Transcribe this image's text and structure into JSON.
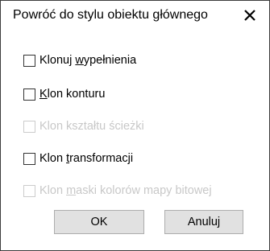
{
  "dialog": {
    "title": "Powróć do stylu obiektu głównego",
    "close_icon": "close-icon"
  },
  "options": [
    {
      "pre": "Klonuj ",
      "u": "w",
      "post": "ypełnienia",
      "checked": false,
      "disabled": false
    },
    {
      "pre": "",
      "u": "K",
      "post": "lon konturu",
      "checked": false,
      "disabled": false
    },
    {
      "pre": "Klon kształtu ścieżki",
      "u": "",
      "post": "",
      "checked": false,
      "disabled": true
    },
    {
      "pre": "Klon ",
      "u": "t",
      "post": "ransformacji",
      "checked": false,
      "disabled": false
    },
    {
      "pre": "Klon ",
      "u": "m",
      "post": "aski kolorów mapy bitowej",
      "checked": false,
      "disabled": true
    }
  ],
  "buttons": {
    "ok": "OK",
    "cancel": "Anuluj"
  },
  "colors": {
    "button_bg": "#e1e1e1",
    "button_border": "#adadad",
    "disabled_text": "#c8c8c8"
  }
}
